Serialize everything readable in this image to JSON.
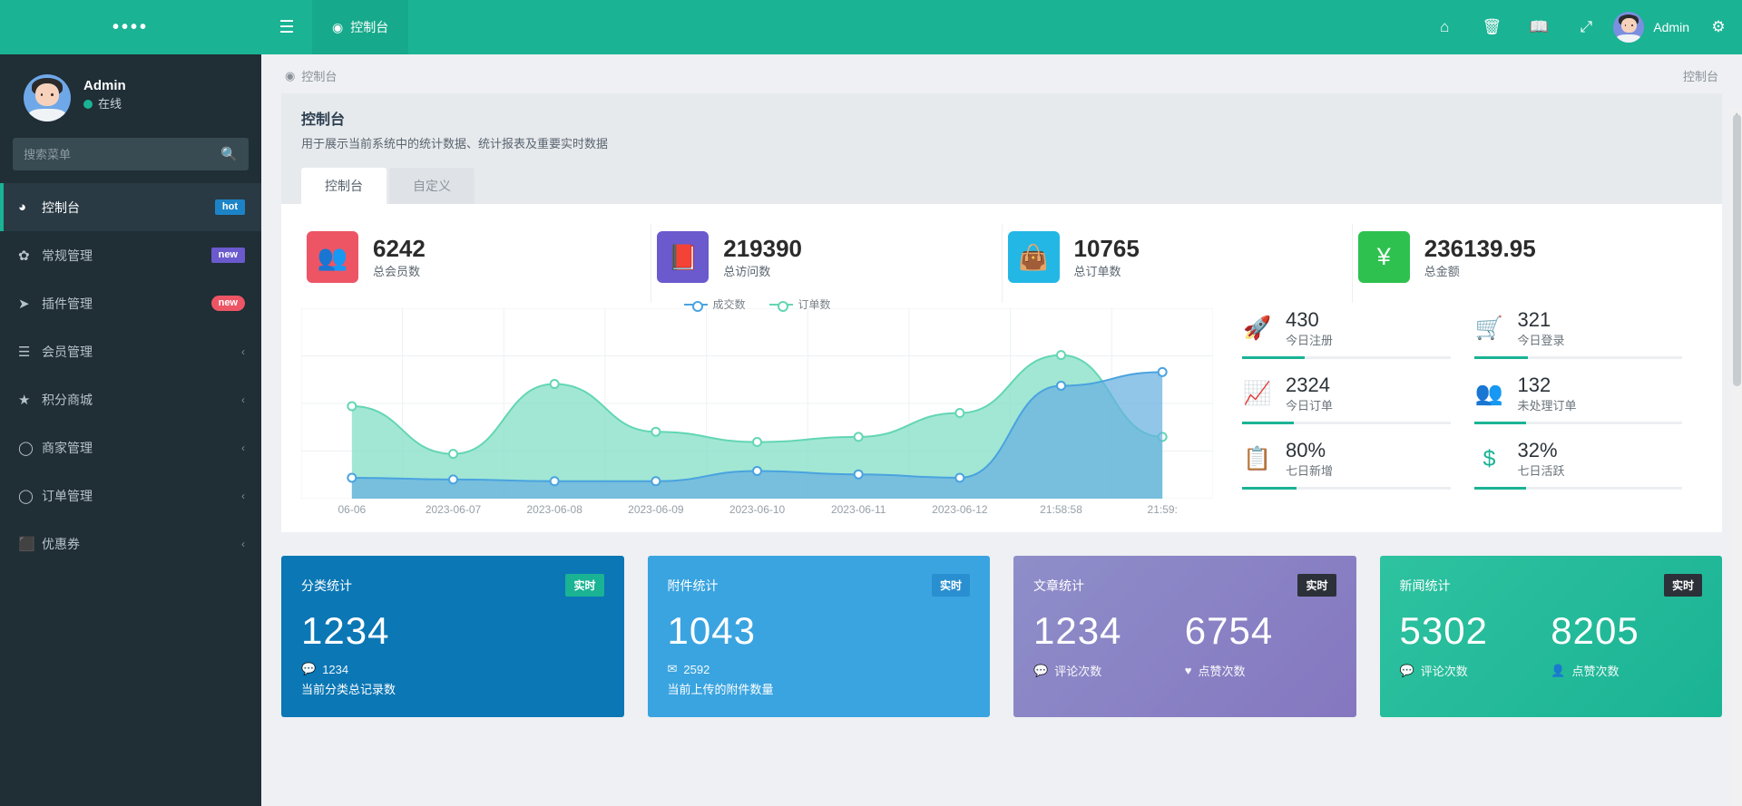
{
  "sidebar": {
    "logo": "••••",
    "profile": {
      "name": "Admin",
      "status": "在线"
    },
    "search": {
      "placeholder": "搜索菜单",
      "value": ""
    },
    "items": [
      {
        "icon": "dashboard-icon",
        "glyph": "◕",
        "label": "控制台",
        "badge": "hot",
        "badge_type": "hot",
        "active": true
      },
      {
        "icon": "gears-icon",
        "glyph": "✿",
        "label": "常规管理",
        "badge": "new",
        "badge_type": "new-p",
        "active": false
      },
      {
        "icon": "rocket-icon",
        "glyph": "➤",
        "label": "插件管理",
        "badge": "new",
        "badge_type": "new-r",
        "active": false
      },
      {
        "icon": "list-icon",
        "glyph": "☰",
        "label": "会员管理",
        "chevron": "‹",
        "active": false
      },
      {
        "icon": "star-icon",
        "glyph": "★",
        "label": "积分商城",
        "chevron": "‹",
        "active": false
      },
      {
        "icon": "circle-icon",
        "glyph": "◯",
        "label": "商家管理",
        "chevron": "‹",
        "active": false
      },
      {
        "icon": "circle-icon",
        "glyph": "◯",
        "label": "订单管理",
        "chevron": "‹",
        "active": false
      },
      {
        "icon": "bookmark-icon",
        "glyph": "⬛",
        "label": "优惠券",
        "chevron": "‹",
        "active": false
      }
    ]
  },
  "topbar": {
    "menu_toggle": "☰",
    "active_tab": "控制台",
    "active_tab_icon": "dashboard-icon",
    "icons": [
      {
        "name": "home-icon",
        "glyph": "⌂"
      },
      {
        "name": "trash-icon",
        "glyph": "🗑"
      },
      {
        "name": "book-icon",
        "glyph": "📖"
      },
      {
        "name": "fullscreen-icon",
        "glyph": "⤢"
      }
    ],
    "user_name": "Admin",
    "settings_icon": "gears-icon"
  },
  "breadcrumb": {
    "icon": "dashboard-icon",
    "text": "控制台",
    "right": "控制台"
  },
  "panel": {
    "title": "控制台",
    "subtitle": "用于展示当前系统中的统计数据、统计报表及重要实时数据",
    "tabs": [
      {
        "label": "控制台",
        "active": true
      },
      {
        "label": "自定义",
        "active": false
      }
    ]
  },
  "stats": [
    {
      "icon": "users-icon",
      "glyph": "👥",
      "color": "#ed5565",
      "value": "6242",
      "label": "总会员数"
    },
    {
      "icon": "book-icon",
      "glyph": "📕",
      "color": "#6a5acd",
      "value": "219390",
      "label": "总访问数"
    },
    {
      "icon": "bag-icon",
      "glyph": "👜",
      "color": "#23b7e5",
      "value": "10765",
      "label": "总订单数"
    },
    {
      "icon": "yen-icon",
      "glyph": "¥",
      "color": "#2ec14f",
      "value": "236139.95",
      "label": "总金额"
    }
  ],
  "mini_stats": [
    {
      "icon": "rocket-icon",
      "glyph": "🚀",
      "value": "430",
      "label": "今日注册",
      "bar": 30
    },
    {
      "icon": "cart-icon",
      "glyph": "🛒",
      "value": "321",
      "label": "今日登录",
      "bar": 26
    },
    {
      "icon": "chart-line-icon",
      "glyph": "📈",
      "value": "2324",
      "label": "今日订单",
      "bar": 25
    },
    {
      "icon": "group-icon",
      "glyph": "👥",
      "value": "132",
      "label": "未处理订单",
      "bar": 25
    },
    {
      "icon": "news-icon",
      "glyph": "📋",
      "value": "80%",
      "label": "七日新增",
      "bar": 26
    },
    {
      "icon": "dollar-icon",
      "glyph": "$",
      "value": "32%",
      "label": "七日活跃",
      "bar": 25
    }
  ],
  "bottom_cards": [
    {
      "title": "分类统计",
      "badge": "实时",
      "badge_bg": "#1ab394",
      "badge_color": "#ffffff",
      "bg": "#0b77b5",
      "values": [
        {
          "number": "1234",
          "foot_icon": "comment-icon",
          "foot_glyph": "💬",
          "foot": "1234"
        }
      ],
      "sub": "当前分类总记录数"
    },
    {
      "title": "附件统计",
      "badge": "实时",
      "badge_bg": "#2a8fd0",
      "badge_color": "#ffffff",
      "bg": "#3aa4e0",
      "values": [
        {
          "number": "1043",
          "foot_icon": "attachment-icon",
          "foot_glyph": "✉",
          "foot": "2592"
        }
      ],
      "sub": "当前上传的附件数量"
    },
    {
      "title": "文章统计",
      "badge": "实时",
      "badge_bg": "#2c3038",
      "badge_color": "#ffffff",
      "bg": "linear-gradient(135deg,#8e8ec9 0%,#8577c0 100%)",
      "values": [
        {
          "number": "1234",
          "foot_icon": "comment-icon",
          "foot_glyph": "💬",
          "foot": "评论次数"
        },
        {
          "number": "6754",
          "foot_icon": "heart-icon",
          "foot_glyph": "♥",
          "foot": "点赞次数"
        }
      ],
      "sub": ""
    },
    {
      "title": "新闻统计",
      "badge": "实时",
      "badge_bg": "#2c3038",
      "badge_color": "#ffffff",
      "bg": "linear-gradient(135deg,#2ec2a0 0%,#1ab394 100%)",
      "values": [
        {
          "number": "5302",
          "foot_icon": "comment-icon",
          "foot_glyph": "💬",
          "foot": "评论次数"
        },
        {
          "number": "8205",
          "foot_icon": "user-icon",
          "foot_glyph": "👤",
          "foot": "点赞次数"
        }
      ],
      "sub": ""
    }
  ],
  "chart_data": {
    "type": "area",
    "title": "",
    "xlabel": "",
    "ylabel": "",
    "grid": true,
    "legend_position": "top-center",
    "categories": [
      "06-06",
      "2023-06-07",
      "2023-06-08",
      "2023-06-09",
      "2023-06-10",
      "2023-06-11",
      "2023-06-12",
      "21:58:58",
      "21:59:"
    ],
    "ylim": [
      0,
      100
    ],
    "series": [
      {
        "name": "成交数",
        "color": "#4aa3df",
        "values": [
          8,
          7,
          6,
          6,
          12,
          10,
          8,
          62,
          70
        ]
      },
      {
        "name": "订单数",
        "color": "#63d6b4",
        "values": [
          50,
          22,
          63,
          35,
          29,
          32,
          46,
          80,
          32
        ]
      }
    ]
  }
}
